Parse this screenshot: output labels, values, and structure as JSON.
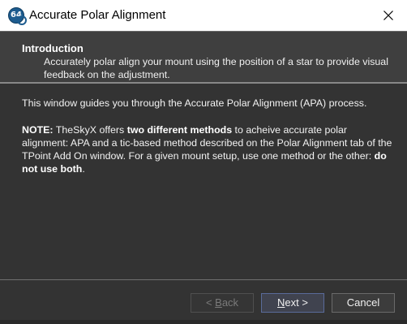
{
  "window": {
    "title": "Accurate Polar Alignment",
    "app_icon_label": "64"
  },
  "header": {
    "title": "Introduction",
    "description": "Accurately polar align your mount using the position of a star to provide visual feedback on the adjustment."
  },
  "content": {
    "intro": "This window guides you through the Accurate Polar Alignment (APA) process.",
    "note": {
      "label": "NOTE:",
      "text_1": " TheSkyX offers ",
      "emphasis_1": "two different methods",
      "text_2": " to acheive accurate polar alignment: APA and a tic-based method described on the Polar Alignment tab of the TPoint Add On window. For a given mount setup, use one method or the other: ",
      "emphasis_2": "do not use both",
      "text_3": "."
    }
  },
  "buttons": {
    "back": {
      "prefix": "< ",
      "accel": "B",
      "rest": "ack",
      "enabled": false
    },
    "next": {
      "accel": "N",
      "rest": "ext >",
      "enabled": true
    },
    "cancel": {
      "label": "Cancel",
      "enabled": true
    }
  },
  "colors": {
    "window_bg": "#333333",
    "header_bg": "#3f3f3f",
    "titlebar_bg": "#ffffff",
    "text": "#f2f2f2",
    "disabled_text": "#7a7a7a",
    "default_button_border": "#5a6b9a"
  },
  "icons": {
    "close": "close-icon",
    "app": "app-icon"
  }
}
